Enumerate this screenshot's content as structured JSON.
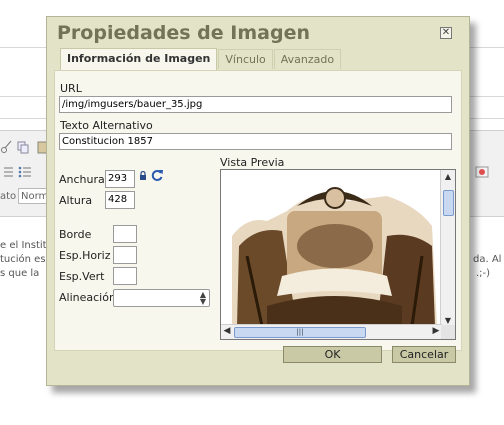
{
  "background": {
    "text_lines": [
      "e el Instit",
      "tución es",
      "s que la"
    ],
    "right_text_lines": [
      "da. Al",
      ".;-)"
    ],
    "toolbar_label": "ato",
    "format_select": "Norm"
  },
  "dialog": {
    "title": "Propiedades de Imagen",
    "close_label": "✕",
    "tabs": [
      {
        "label": "Información de Imagen",
        "active": true
      },
      {
        "label": "Vínculo",
        "active": false
      },
      {
        "label": "Avanzado",
        "active": false
      }
    ],
    "url": {
      "label": "URL",
      "value": "/img/imgusers/bauer_35.jpg"
    },
    "alt": {
      "label": "Texto Alternativo",
      "value": "Constitucion 1857"
    },
    "width": {
      "label": "Anchura",
      "value": "293"
    },
    "height": {
      "label": "Altura",
      "value": "428"
    },
    "border": {
      "label": "Borde",
      "value": ""
    },
    "hspace": {
      "label": "Esp.Horiz",
      "value": ""
    },
    "vspace": {
      "label": "Esp.Vert",
      "value": ""
    },
    "align": {
      "label": "Alineación",
      "value": ""
    },
    "preview_label": "Vista Previa",
    "ok_label": "OK",
    "cancel_label": "Cancelar"
  }
}
